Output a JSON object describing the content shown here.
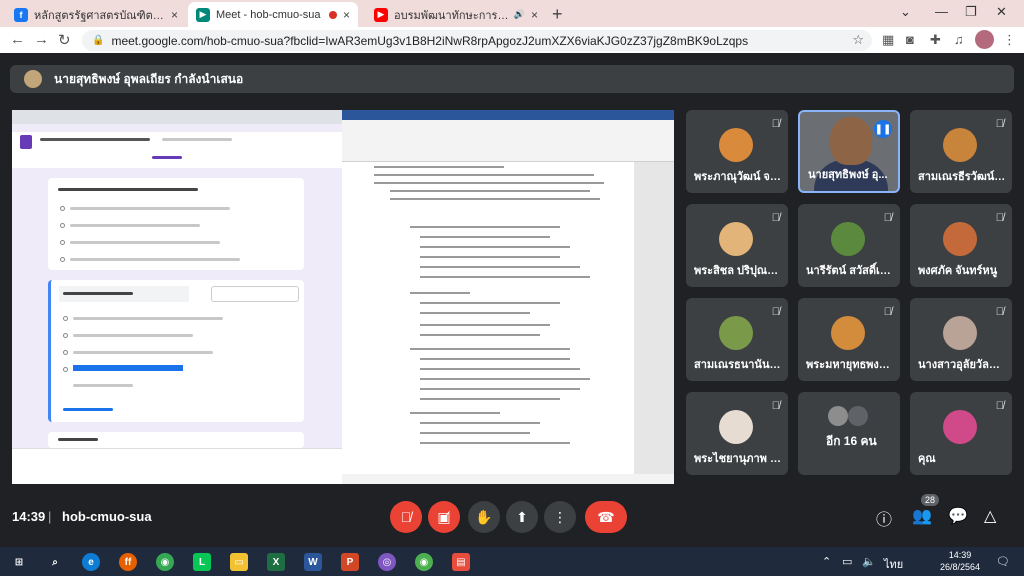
{
  "browser": {
    "tabs": [
      {
        "title": "หลักสูตรรัฐศาสตรบัณฑิต มจร วิทยาเขตขอนแก่น",
        "close": "×"
      },
      {
        "title": "Meet - hob-cmuo-sua",
        "close": "×"
      },
      {
        "title": "อบรมพัฒนาทักษะการเขียน (Writing Skill)",
        "close": "×"
      }
    ],
    "new_tab": "+",
    "url": "meet.google.com/hob-cmuo-sua?fbclid=IwAR3emUg3v1B8H2iNwR8rpApgozJ2umXZX6viaKJG0zZ37jgZ8mBK9oLzqps"
  },
  "meet": {
    "presenter_text": "นายสุทธิพงษ์ อุพลเถียร กำลังนำเสนอ",
    "participants": [
      {
        "name": "พระภาณุวัฒน์ จนฺ...",
        "avatar_color": "#d98a3a"
      },
      {
        "name": "นายสุทธิพงษ์ อุ...",
        "speaking": true
      },
      {
        "name": "สามเณรธีรวัฒน์ โ...",
        "avatar_color": "#c9843c"
      },
      {
        "name": "พระสิชล ปริปุณโณ",
        "avatar_color": "#e3b47a"
      },
      {
        "name": "นารีรัตน์ สวัสดิ์เมือง",
        "avatar_color": "#5b8a3e"
      },
      {
        "name": "พงศภัค จันทร์หนู",
        "avatar_color": "#c46a3a"
      },
      {
        "name": "สามเณรธนานันท์ ...",
        "avatar_color": "#7a9a4a"
      },
      {
        "name": "พระมหายุทธพงศ์...",
        "avatar_color": "#d28c3c"
      },
      {
        "name": "นางสาวอุลัยวัลย์ ...",
        "avatar_color": "#b9a397"
      },
      {
        "name": "พระไชยานุภาพ ส...",
        "avatar_color": "#e6dcd2"
      },
      {
        "name": "อีก 16 คน"
      },
      {
        "name": "คุณ",
        "avatar_color": "#d04a8a"
      }
    ],
    "time": "14:39",
    "separator": "|",
    "meeting_code": "hob-cmuo-sua",
    "participant_count": "28"
  },
  "taskbar": {
    "lang": "ไทย",
    "time": "14:39",
    "date": "26/8/2564"
  }
}
